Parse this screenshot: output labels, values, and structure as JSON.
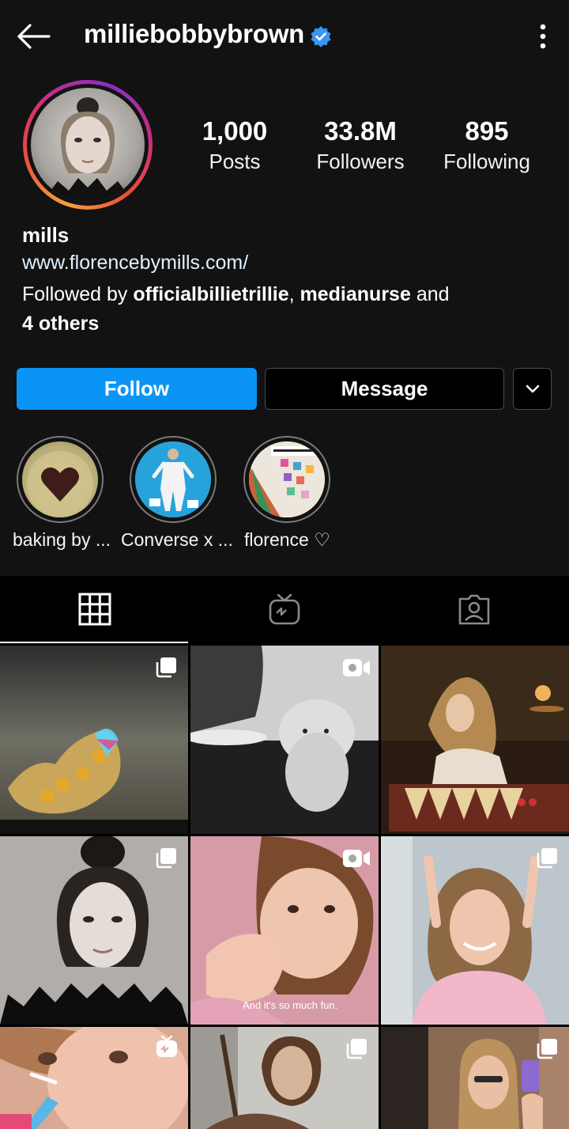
{
  "header": {
    "username": "milliebobbybrown",
    "back_icon": "back-arrow-icon",
    "verified_icon": "verified-badge-icon",
    "more_icon": "more-options-icon"
  },
  "stats": {
    "posts": {
      "value": "1,000",
      "label": "Posts"
    },
    "followers": {
      "value": "33.8M",
      "label": "Followers"
    },
    "following": {
      "value": "895",
      "label": "Following"
    }
  },
  "bio": {
    "name": "mills",
    "website": "www.florencebymills.com/",
    "followed_by_prefix": "Followed by ",
    "followed_user_1": "officialbillietrillie",
    "separator": ", ",
    "followed_user_2": "medianurse",
    "conjunction": " and",
    "others": "4 others"
  },
  "actions": {
    "follow": "Follow",
    "message": "Message",
    "more_icon": "chevron-down-icon"
  },
  "highlights": [
    {
      "label": "baking by ..."
    },
    {
      "label": "Converse x ..."
    },
    {
      "label": "florence ♡"
    }
  ],
  "tabs": [
    {
      "icon": "grid-icon",
      "active": true
    },
    {
      "icon": "igtv-icon",
      "active": false
    },
    {
      "icon": "tagged-icon",
      "active": false
    }
  ],
  "posts": [
    {
      "type": "carousel"
    },
    {
      "type": "video"
    },
    {
      "type": "photo"
    },
    {
      "type": "carousel"
    },
    {
      "type": "video",
      "caption": "And it's so much fun."
    },
    {
      "type": "carousel"
    },
    {
      "type": "igtv"
    },
    {
      "type": "carousel"
    },
    {
      "type": "carousel"
    }
  ],
  "colors": {
    "accent": "#0a95f6",
    "background": "#121212",
    "verified": "#3897f0"
  }
}
